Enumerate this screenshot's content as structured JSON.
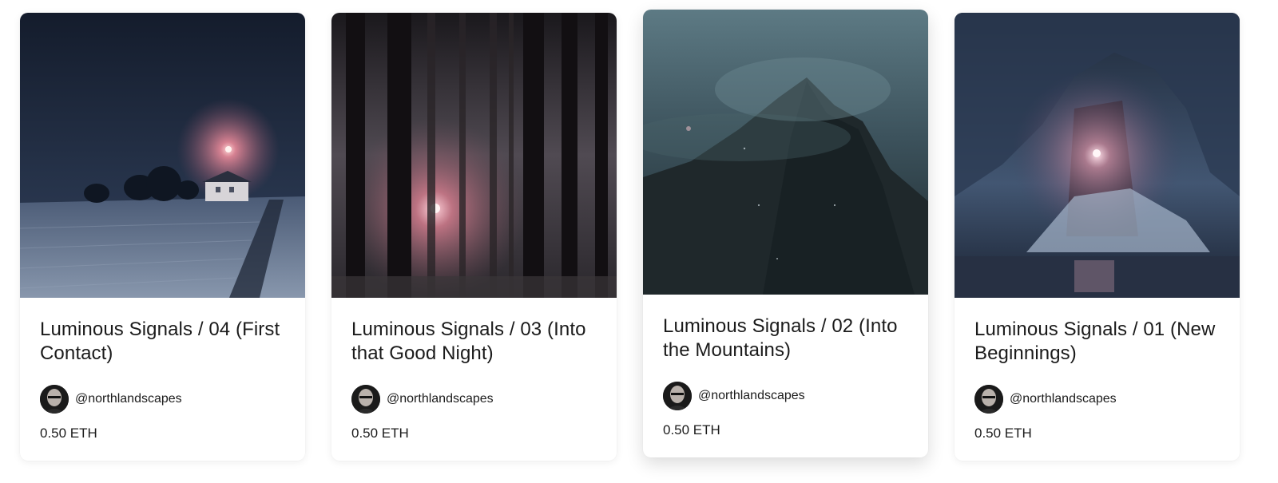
{
  "currency_color": "#1b1b1b",
  "cards": [
    {
      "title": "Luminous Signals / 04 (First Contact)",
      "creator": "@northlandscapes",
      "price": "0.50 ETH",
      "image": "snowy-field-night-house"
    },
    {
      "title": "Luminous Signals / 03 (Into that Good Night)",
      "creator": "@northlandscapes",
      "price": "0.50 ETH",
      "image": "misty-forest-pink-light"
    },
    {
      "title": "Luminous Signals / 02 (Into the Mountains)",
      "creator": "@northlandscapes",
      "price": "0.50 ETH",
      "image": "foggy-mountain-peak"
    },
    {
      "title": "Luminous Signals / 01 (New Beginnings)",
      "creator": "@northlandscapes",
      "price": "0.50 ETH",
      "image": "glacier-cave-light"
    }
  ]
}
